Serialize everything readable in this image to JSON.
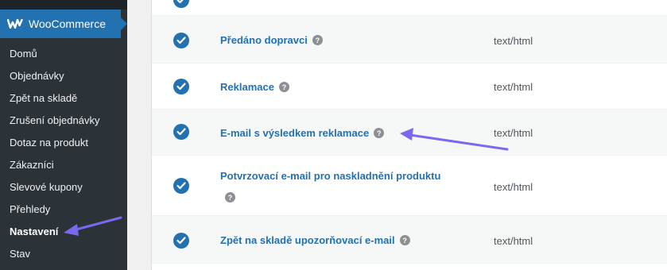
{
  "sidebar": {
    "brand": {
      "logo": "woocommerce-logo",
      "title": "WooCommerce"
    },
    "items": [
      {
        "label": "Domů"
      },
      {
        "label": "Objednávky"
      },
      {
        "label": "Zpět na skladě"
      },
      {
        "label": "Zrušení objednávky"
      },
      {
        "label": "Dotaz na produkt"
      },
      {
        "label": "Zákazníci"
      },
      {
        "label": "Slevové kupony"
      },
      {
        "label": "Přehledy"
      },
      {
        "label": "Nastavení",
        "active": true
      },
      {
        "label": "Stav"
      }
    ]
  },
  "emails": {
    "rows": [
      {
        "title": "Předáno dopravci",
        "content_type": "text/html",
        "enabled": true
      },
      {
        "title": "Reklamace",
        "content_type": "text/html",
        "enabled": true
      },
      {
        "title": "E-mail s výsledkem reklamace",
        "content_type": "text/html",
        "enabled": true
      },
      {
        "title": "Potvrzovací e-mail pro naskladnění produktu",
        "content_type": "text/html",
        "enabled": true
      },
      {
        "title": "Zpět na skladě upozorňovací e-mail",
        "content_type": "text/html",
        "enabled": true
      }
    ],
    "help_icon": "question-circle-icon",
    "check_icon": "checkmark-circle-icon"
  },
  "colors": {
    "sidebar_bg": "#2c3338",
    "sidebar_active_bg": "#2271b1",
    "link": "#2271b1",
    "annotation_arrow": "#7b68ee"
  }
}
